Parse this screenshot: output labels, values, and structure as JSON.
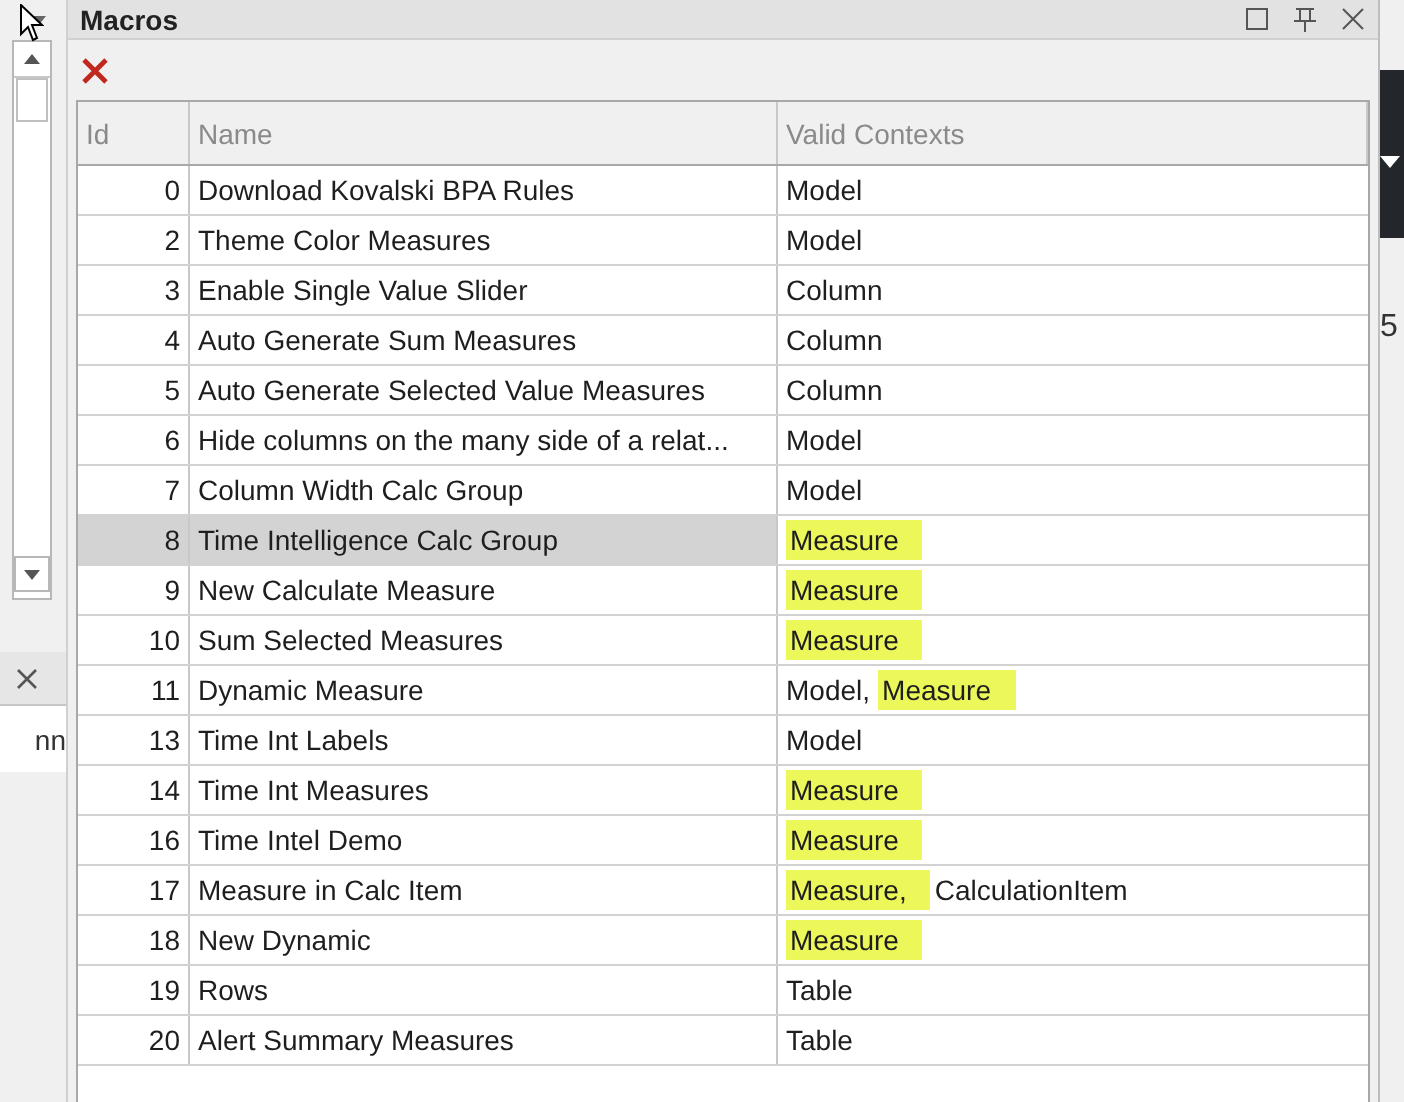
{
  "left_panel": {
    "lower_tab_text": "nn"
  },
  "window": {
    "title": "Macros"
  },
  "table": {
    "columns": [
      "Id",
      "Name",
      "Valid Contexts"
    ],
    "rows": [
      {
        "id": "0",
        "name": "Download Kovalski BPA Rules",
        "selected": false,
        "contexts": [
          {
            "text": "Model",
            "highlighted": false
          }
        ]
      },
      {
        "id": "2",
        "name": "Theme Color Measures",
        "selected": false,
        "contexts": [
          {
            "text": "Model",
            "highlighted": false
          }
        ]
      },
      {
        "id": "3",
        "name": "Enable Single Value Slider",
        "selected": false,
        "contexts": [
          {
            "text": "Column",
            "highlighted": false
          }
        ]
      },
      {
        "id": "4",
        "name": "Auto Generate Sum Measures",
        "selected": false,
        "contexts": [
          {
            "text": "Column",
            "highlighted": false
          }
        ]
      },
      {
        "id": "5",
        "name": "Auto Generate Selected Value Measures",
        "selected": false,
        "contexts": [
          {
            "text": "Column",
            "highlighted": false
          }
        ]
      },
      {
        "id": "6",
        "name": "Hide columns on the many side of a relat...",
        "selected": false,
        "contexts": [
          {
            "text": "Model",
            "highlighted": false
          }
        ]
      },
      {
        "id": "7",
        "name": "Column Width Calc Group",
        "selected": false,
        "contexts": [
          {
            "text": "Model",
            "highlighted": false
          }
        ]
      },
      {
        "id": "8",
        "name": "Time Intelligence Calc Group",
        "selected": true,
        "contexts": [
          {
            "text": "Measure",
            "highlighted": true
          }
        ]
      },
      {
        "id": "9",
        "name": "New Calculate Measure",
        "selected": false,
        "contexts": [
          {
            "text": "Measure",
            "highlighted": true
          }
        ]
      },
      {
        "id": "10",
        "name": "Sum Selected Measures",
        "selected": false,
        "contexts": [
          {
            "text": "Measure",
            "highlighted": true
          }
        ]
      },
      {
        "id": "11",
        "name": "Dynamic Measure",
        "selected": false,
        "contexts": [
          {
            "text": "Model,",
            "highlighted": false
          },
          {
            "text": "Measure",
            "highlighted": true
          }
        ]
      },
      {
        "id": "13",
        "name": "Time Int Labels",
        "selected": false,
        "contexts": [
          {
            "text": "Model",
            "highlighted": false
          }
        ]
      },
      {
        "id": "14",
        "name": "Time Int Measures",
        "selected": false,
        "contexts": [
          {
            "text": "Measure",
            "highlighted": true
          }
        ]
      },
      {
        "id": "16",
        "name": "Time Intel Demo",
        "selected": false,
        "contexts": [
          {
            "text": "Measure",
            "highlighted": true
          }
        ]
      },
      {
        "id": "17",
        "name": "Measure in Calc Item",
        "selected": false,
        "contexts": [
          {
            "text": "Measure,",
            "highlighted": true
          },
          {
            "text": "CalculationItem",
            "highlighted": false
          }
        ]
      },
      {
        "id": "18",
        "name": "New Dynamic",
        "selected": false,
        "contexts": [
          {
            "text": "Measure",
            "highlighted": true
          }
        ]
      },
      {
        "id": "19",
        "name": "Rows",
        "selected": false,
        "contexts": [
          {
            "text": "Table",
            "highlighted": false
          }
        ]
      },
      {
        "id": "20",
        "name": "Alert Summary Measures",
        "selected": false,
        "contexts": [
          {
            "text": "Table",
            "highlighted": false
          }
        ]
      }
    ]
  },
  "right_panel": {
    "cut_text": "5"
  }
}
